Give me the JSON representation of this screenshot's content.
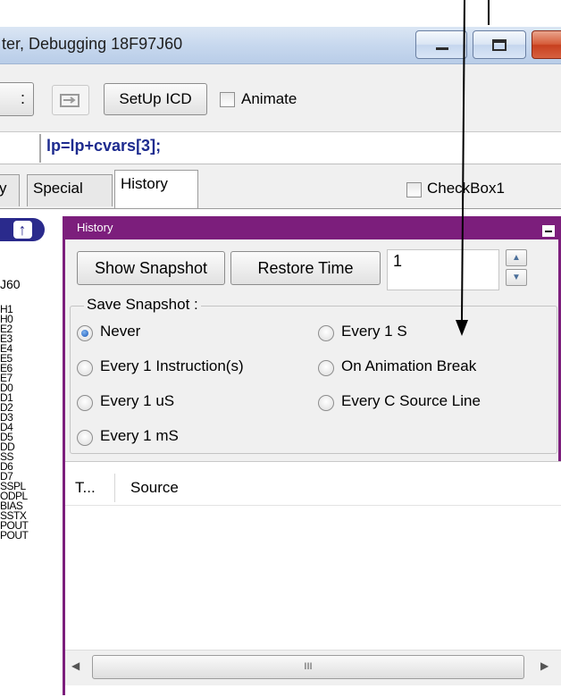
{
  "window": {
    "title": "ter, Debugging 18F97J60"
  },
  "toolbar": {
    "left_button_fragment": ":",
    "setup_label": "SetUp ICD",
    "animate_label": "Animate"
  },
  "source": {
    "code": "lp=lp+cvars[3];"
  },
  "tabs": [
    {
      "label": "y"
    },
    {
      "label": "Special"
    },
    {
      "label": "History"
    }
  ],
  "checkbox1_label": "CheckBox1",
  "left": {
    "arrow_glyph": "↑",
    "label60": "J60",
    "registers": [
      "H1",
      "H0",
      "E2",
      "E3",
      "E4",
      "E5",
      "E6",
      "E7",
      "D0",
      "D1",
      "D2",
      "D3",
      "D4",
      "D5",
      "DD",
      "SS",
      "D6",
      "D7",
      "SSPL",
      "ODPL",
      "BIAS",
      "SSTX",
      "POUT",
      "POUT"
    ]
  },
  "panel": {
    "title": "History",
    "show_snapshot": "Show Snapshot",
    "restore_time": "Restore Time",
    "input_value": "1",
    "group_label": "Save Snapshot :",
    "options": [
      {
        "label": "Never",
        "checked": true
      },
      {
        "label": "Every 1 Instruction(s)",
        "checked": false
      },
      {
        "label": "Every 1 uS",
        "checked": false
      },
      {
        "label": "Every 1 mS",
        "checked": false
      },
      {
        "label": "Every 1 S",
        "checked": false
      },
      {
        "label": "On Animation Break",
        "checked": false
      },
      {
        "label": "Every C Source Line",
        "checked": false
      }
    ],
    "columns": [
      "T...",
      "Source"
    ],
    "scroll_thumb_glyph": "III"
  },
  "colors": {
    "panel_border": "#7c1e7c",
    "source_code": "#1d2b8f",
    "arrow_badge": "#2a2a8c"
  }
}
